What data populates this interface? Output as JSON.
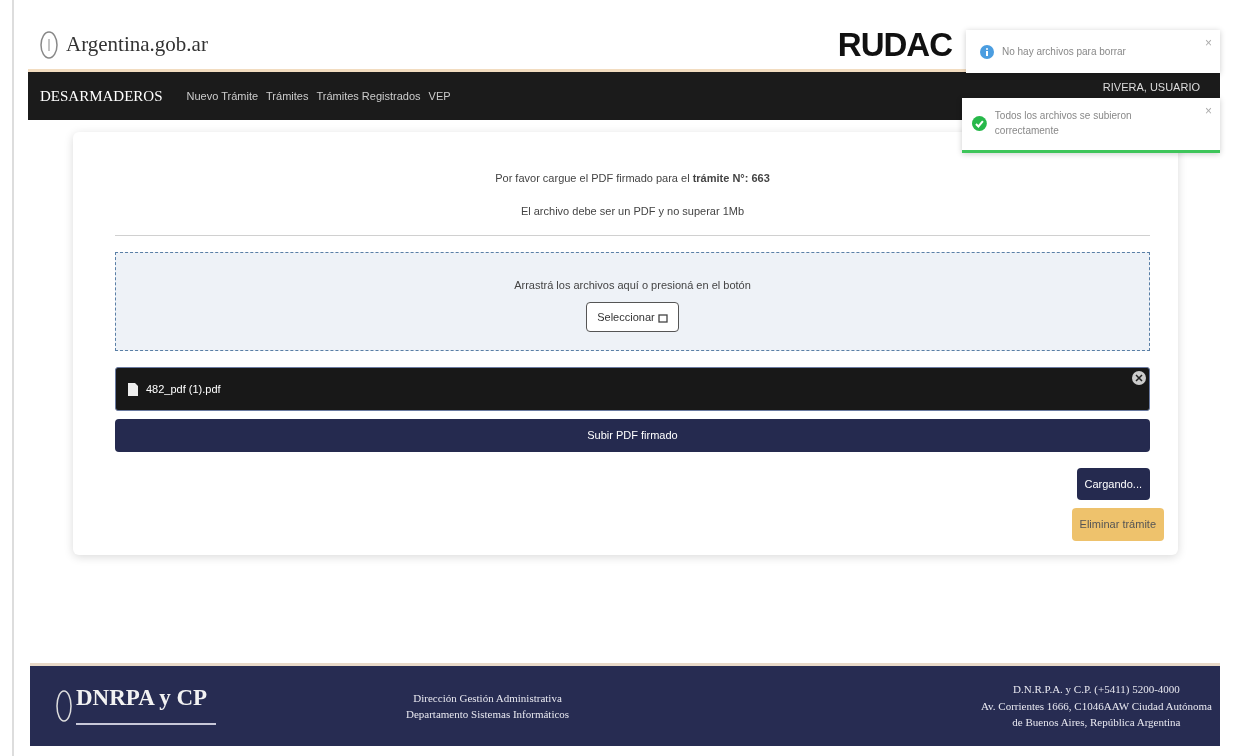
{
  "header": {
    "site_name": "Argentina.gob.ar",
    "brand": "RUDAC"
  },
  "navbar": {
    "title": "DESARMADEROS",
    "links": [
      "Nuevo Trámite",
      "Trámites",
      "Trámites Registrados",
      "VEP"
    ],
    "user": "RIVERA, USUARIO"
  },
  "notifications": [
    {
      "kind": "info",
      "message": "No hay archivos para borrar",
      "close": "×"
    },
    {
      "kind": "success",
      "message": "Todos los archivos se subieron correctamente",
      "close": "×",
      "level": 1
    }
  ],
  "upload": {
    "instruction": "Por favor cargue el PDF firmado para el **trámite N°: 663**",
    "requirement": "El archivo debe ser un PDF y no superar 1Mb",
    "dropzone_text": "Arrastrá los archivos aquí o presioná en el botón",
    "select_button": "Seleccionar",
    "file_name": "482_pdf (1).pdf",
    "upload_button": "Subir PDF firmado",
    "loading_button": "Cargando...",
    "delete_button": "Eliminar trámite"
  },
  "footer": {
    "logo_text": "DNRPA y CP",
    "center_lines": [
      "Dirección Gestión Administrativa",
      "Departamento Sistemas Informáticos"
    ],
    "right_lines": [
      "D.N.R.P.A. y C.P. (+5411) 5200-4000",
      "Av. Corrientes 1666, C1046AAW Ciudad Autónoma",
      "de Buenos Aires, República Argentina"
    ]
  }
}
